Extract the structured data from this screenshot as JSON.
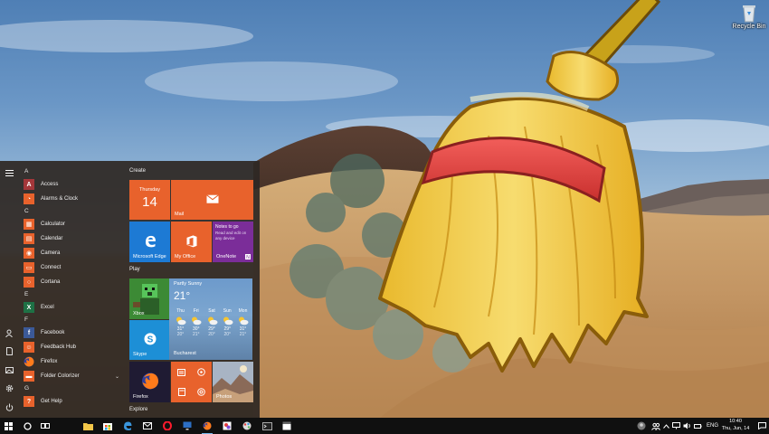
{
  "desktop": {
    "recycle_bin_label": "Recycle Bin"
  },
  "start_menu": {
    "sections": [
      {
        "letter": "A",
        "apps": [
          {
            "label": "Access",
            "icon": "access-icon",
            "color": "#a4373a",
            "glyph": "A"
          },
          {
            "label": "Alarms & Clock",
            "icon": "alarm-clock-icon",
            "color": "#e8622c",
            "glyph": "◔"
          }
        ]
      },
      {
        "letter": "C",
        "apps": [
          {
            "label": "Calculator",
            "icon": "calculator-icon",
            "color": "#e8622c",
            "glyph": "▦"
          },
          {
            "label": "Calendar",
            "icon": "calendar-icon",
            "color": "#e8622c",
            "glyph": "▤"
          },
          {
            "label": "Camera",
            "icon": "camera-icon",
            "color": "#e8622c",
            "glyph": "◉"
          },
          {
            "label": "Connect",
            "icon": "connect-icon",
            "color": "#e8622c",
            "glyph": "▭"
          },
          {
            "label": "Cortana",
            "icon": "cortana-icon",
            "color": "#e8622c",
            "glyph": "○"
          }
        ]
      },
      {
        "letter": "E",
        "apps": [
          {
            "label": "Excel",
            "icon": "excel-icon",
            "color": "#1e7145",
            "glyph": "X"
          }
        ]
      },
      {
        "letter": "F",
        "apps": [
          {
            "label": "Facebook",
            "icon": "facebook-icon",
            "color": "#3b5998",
            "glyph": "f"
          },
          {
            "label": "Feedback Hub",
            "icon": "feedback-hub-icon",
            "color": "#e8622c",
            "glyph": "☺"
          },
          {
            "label": "Firefox",
            "icon": "firefox-icon",
            "color": "transparent",
            "glyph": ""
          },
          {
            "label": "Folder Colorizer",
            "icon": "folder-icon",
            "color": "#e8622c",
            "glyph": "▬",
            "has_chevron": true
          }
        ]
      },
      {
        "letter": "G",
        "apps": [
          {
            "label": "Get Help",
            "icon": "get-help-icon",
            "color": "#e8622c",
            "glyph": "?"
          }
        ]
      }
    ],
    "groups": {
      "create": "Create",
      "play": "Play",
      "explore": "Explore"
    },
    "tiles": {
      "calendar_day": "Thursday",
      "calendar_date": "14",
      "mail": "Mail",
      "edge": "Microsoft Edge",
      "office": "My Office",
      "onenote": "OneNote",
      "onenote_title": "Notes to go",
      "onenote_body": "Read and edit on any device",
      "xbox": "Xbox",
      "skype": "Skype",
      "firefox": "Firefox",
      "photos": "Photos"
    },
    "weather": {
      "condition": "Partly Sunny",
      "temperature": "21°",
      "city": "Bucharest",
      "forecast": [
        {
          "day": "Thu",
          "high": "31°",
          "low": "20°"
        },
        {
          "day": "Fri",
          "high": "30°",
          "low": "21°"
        },
        {
          "day": "Sat",
          "high": "29°",
          "low": "20°"
        },
        {
          "day": "Sun",
          "high": "29°",
          "low": "20°"
        },
        {
          "day": "Mon",
          "high": "31°",
          "low": "21°"
        }
      ]
    }
  },
  "taskbar": {
    "language": "ENG",
    "time": "10:40",
    "date": "Thu, Jun, 14"
  }
}
